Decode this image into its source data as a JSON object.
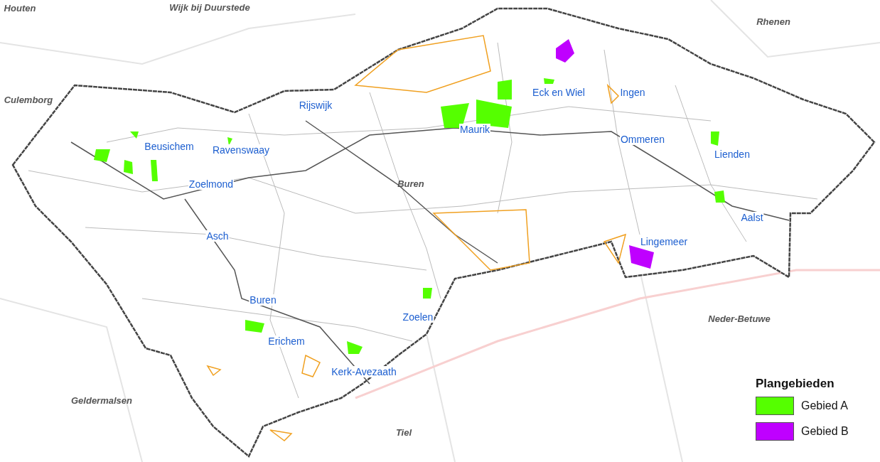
{
  "map": {
    "places": [
      {
        "name": "Houten",
        "kind": "region"
      },
      {
        "name": "Wijk bij Duurstede",
        "kind": "region"
      },
      {
        "name": "Rhenen",
        "kind": "region"
      },
      {
        "name": "Culemborg",
        "kind": "region"
      },
      {
        "name": "Rijswijk",
        "kind": "village"
      },
      {
        "name": "Eck en Wiel",
        "kind": "village"
      },
      {
        "name": "Ingen",
        "kind": "village"
      },
      {
        "name": "Maurik",
        "kind": "village"
      },
      {
        "name": "Beusichem",
        "kind": "village"
      },
      {
        "name": "Ravenswaay",
        "kind": "village"
      },
      {
        "name": "Ommeren",
        "kind": "village"
      },
      {
        "name": "Lienden",
        "kind": "village"
      },
      {
        "name": "Zoelmond",
        "kind": "village"
      },
      {
        "name": "Buren",
        "kind": "region"
      },
      {
        "name": "Aalst",
        "kind": "village"
      },
      {
        "name": "Asch",
        "kind": "village"
      },
      {
        "name": "Lingemeer",
        "kind": "village"
      },
      {
        "name": "Buren",
        "kind": "village"
      },
      {
        "name": "Zoelen",
        "kind": "village"
      },
      {
        "name": "Neder-Betuwe",
        "kind": "region"
      },
      {
        "name": "Erichem",
        "kind": "village"
      },
      {
        "name": "Kerk-Avezaath",
        "kind": "village"
      },
      {
        "name": "Geldermalsen",
        "kind": "region"
      },
      {
        "name": "Tiel",
        "kind": "region"
      }
    ]
  },
  "legend": {
    "title": "Plangebieden",
    "items": [
      {
        "label": "Gebied A",
        "color": "#55ff00"
      },
      {
        "label": "Gebied B",
        "color": "#bf00ff"
      }
    ]
  }
}
